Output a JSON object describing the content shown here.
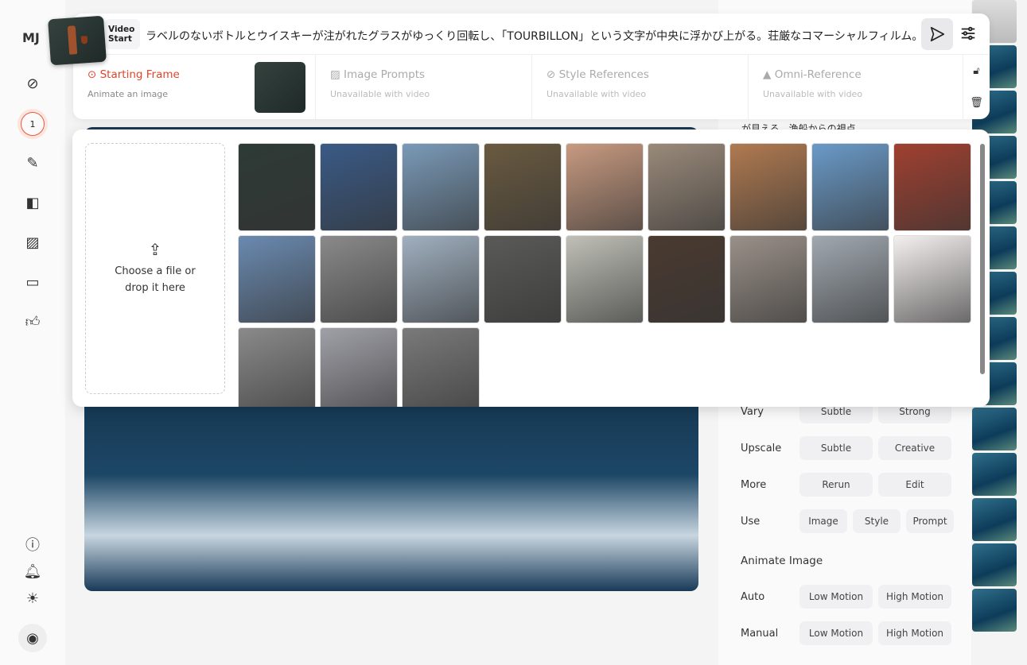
{
  "sidebar": {
    "logo": "MJ",
    "badge": "1",
    "icons": [
      "compass-icon",
      "edit-icon",
      "palette-icon",
      "image-icon",
      "chat-icon",
      "thumbs-up-icon"
    ],
    "bottom_icons": [
      "help-icon",
      "bell-icon",
      "sun-icon",
      "user-icon"
    ]
  },
  "prompt_bar": {
    "mode_label_1": "Video",
    "mode_label_2": "Start",
    "prompt": "ラベルのないボトルとウイスキーが注がれたグラスがゆっくり回転し、「TOURBILLON」という文字が中央に浮かび上がる。荘厳なコマーシャルフィルム。"
  },
  "tabs": [
    {
      "label": "Starting Frame",
      "sub": "Animate an image",
      "icon": "play-circle-icon"
    },
    {
      "label": "Image Prompts",
      "sub": "Unavailable with video",
      "icon": "image-icon"
    },
    {
      "label": "Style References",
      "sub": "Unavailable with video",
      "icon": "paperclip-icon"
    },
    {
      "label": "Omni-Reference",
      "sub": "Unavailable with video",
      "icon": "person-icon"
    }
  ],
  "peek_text": "が見える、漁船からの視点",
  "upload": {
    "line1": "Choose a file or",
    "line2": "drop it here"
  },
  "thumbnails": [
    "#2e3a36",
    "#3a5a86",
    "#7a9ab8",
    "#6a5a40",
    "#c89a80",
    "#9a8a7a",
    "#b07a50",
    "#6a9ac8",
    "#a04030",
    "#6a8ab0",
    "#8a8a8a",
    "#a0b0c0",
    "#5a5a58",
    "#c0c0b8",
    "#4a3a30",
    "#9a9088",
    "#a0a8b0",
    "#f5f0f0",
    "#8a8a8a",
    "#a0a0a8",
    "#7a7a7a"
  ],
  "actions": {
    "vary": {
      "label": "Vary",
      "buttons": [
        "Subtle",
        "Strong"
      ]
    },
    "upscale": {
      "label": "Upscale",
      "buttons": [
        "Subtle",
        "Creative"
      ]
    },
    "more": {
      "label": "More",
      "buttons": [
        "Rerun",
        "Edit"
      ]
    },
    "use": {
      "label": "Use",
      "buttons": [
        "Image",
        "Style",
        "Prompt"
      ]
    },
    "animate_title": "Animate Image",
    "auto": {
      "label": "Auto",
      "buttons": [
        "Low Motion",
        "High Motion"
      ]
    },
    "manual": {
      "label": "Manual",
      "buttons": [
        "Low Motion",
        "High Motion"
      ]
    }
  }
}
